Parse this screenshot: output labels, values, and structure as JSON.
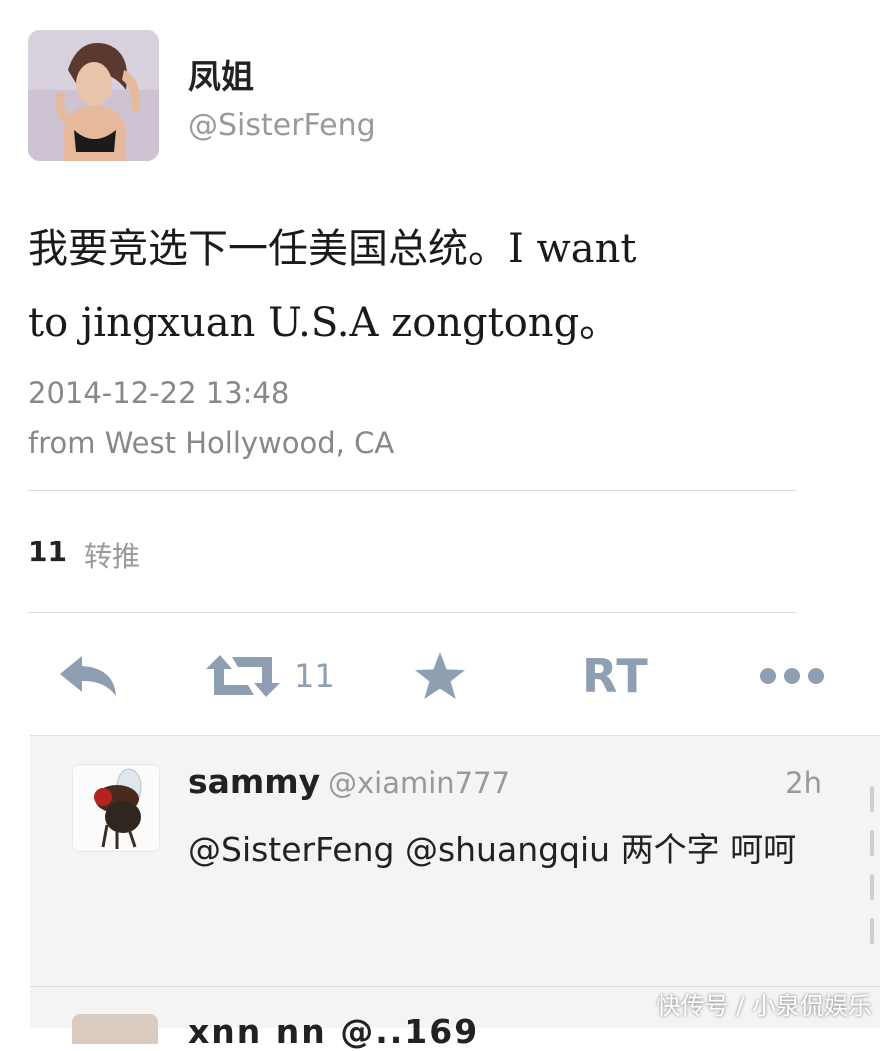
{
  "tweet": {
    "display_name": "凤姐",
    "handle": "@SisterFeng",
    "text_line1": "我要竞选下一任美国总统。I want",
    "text_line2": "to jingxuan U.S.A zongtong。",
    "timestamp": "2014-12-22 13:48",
    "location": "from West Hollywood, CA",
    "retweet_count": "11",
    "retweet_label": "转推"
  },
  "actions": {
    "retweet_count": "11",
    "rt_label": "RT"
  },
  "reply": {
    "name": "sammy",
    "handle": "@xiamin777",
    "time": "2h",
    "text": "@SisterFeng @shuangqiu 两个字 呵呵"
  },
  "reply2": {
    "partial_text": "xnn   nn @..169"
  },
  "watermark": "快传号 / 小泉侃娱乐",
  "icons": [
    "reply-icon",
    "retweet-icon",
    "favorite-star-icon",
    "more-icon"
  ],
  "colors": {
    "action_icon": "#8e9fb1",
    "secondary_text": "#888888"
  }
}
